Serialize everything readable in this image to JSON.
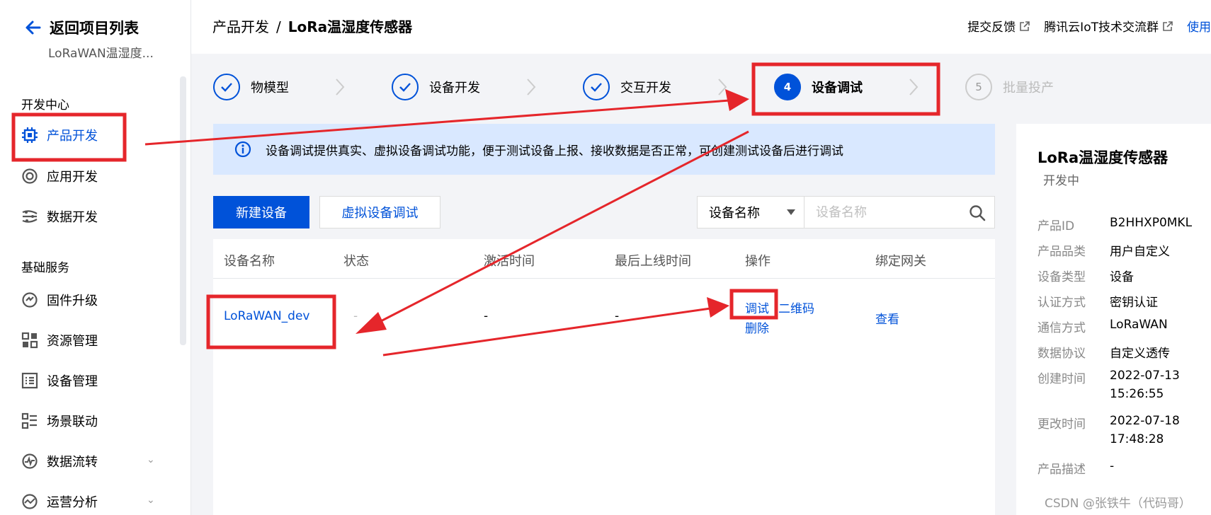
{
  "sidebar": {
    "back_label": "返回项目列表",
    "project_name": "LoRaWAN温湿度...",
    "section_dev": "开发中心",
    "dev_items": [
      {
        "label": "产品开发",
        "icon": "chip-icon"
      },
      {
        "label": "应用开发",
        "icon": "app-icon"
      },
      {
        "label": "数据开发",
        "icon": "data-flow-icon"
      }
    ],
    "section_base": "基础服务",
    "base_items": [
      {
        "label": "固件升级",
        "icon": "firmware-icon"
      },
      {
        "label": "资源管理",
        "icon": "resource-icon"
      },
      {
        "label": "设备管理",
        "icon": "device-list-icon"
      },
      {
        "label": "场景联动",
        "icon": "scene-icon"
      },
      {
        "label": "数据流转",
        "icon": "data-transfer-icon"
      },
      {
        "label": "运营分析",
        "icon": "analytics-icon"
      }
    ]
  },
  "header": {
    "crumb_parent": "产品开发",
    "crumb_sep": "/",
    "crumb_current": "LoRa温湿度传感器",
    "links": [
      "提交反馈",
      "腾讯云IoT技术交流群",
      "使用"
    ]
  },
  "steps": [
    {
      "label": "物模型",
      "state": "done"
    },
    {
      "label": "设备开发",
      "state": "done"
    },
    {
      "label": "交互开发",
      "state": "done"
    },
    {
      "label": "设备调试",
      "state": "current",
      "num": "4"
    },
    {
      "label": "批量投产",
      "state": "todo",
      "num": "5"
    }
  ],
  "banner": {
    "text": "设备调试提供真实、虚拟设备调试功能，便于测试设备上报、接收数据是否正常，可创建测试设备后进行调试"
  },
  "toolbar": {
    "new_device": "新建设备",
    "virtual_debug": "虚拟设备调试",
    "filter_value": "设备名称",
    "search_placeholder": "设备名称"
  },
  "table": {
    "headers": [
      "设备名称",
      "状态",
      "激活时间",
      "最后上线时间",
      "操作",
      "绑定网关"
    ],
    "rows": [
      {
        "name": "LoRaWAN_dev",
        "status": "-",
        "activated": "-",
        "last_online": "-",
        "action_debug": "调试",
        "action_qr": "二维码",
        "action_delete": "删除",
        "gateway": "查看"
      }
    ]
  },
  "panel": {
    "title": "LoRa温湿度传感器",
    "status": "开发中",
    "fields": [
      {
        "label": "产品ID",
        "value": "B2HHXP0MKL"
      },
      {
        "label": "产品品类",
        "value": "用户自定义"
      },
      {
        "label": "设备类型",
        "value": "设备"
      },
      {
        "label": "认证方式",
        "value": "密钥认证"
      },
      {
        "label": "通信方式",
        "value": "LoRaWAN"
      },
      {
        "label": "数据协议",
        "value": "自定义透传"
      },
      {
        "label": "创建时间",
        "value": "2022-07-13",
        "value2": "15:26:55"
      },
      {
        "label": "更改时间",
        "value": "2022-07-18",
        "value2": "17:48:28"
      },
      {
        "label": "产品描述",
        "value": "-"
      }
    ]
  },
  "watermark": "CSDN @张铁牛（代码哥）",
  "colors": {
    "brand": "#0052d9",
    "banner": "#d9e8ff",
    "annotation": "#e5262b"
  }
}
